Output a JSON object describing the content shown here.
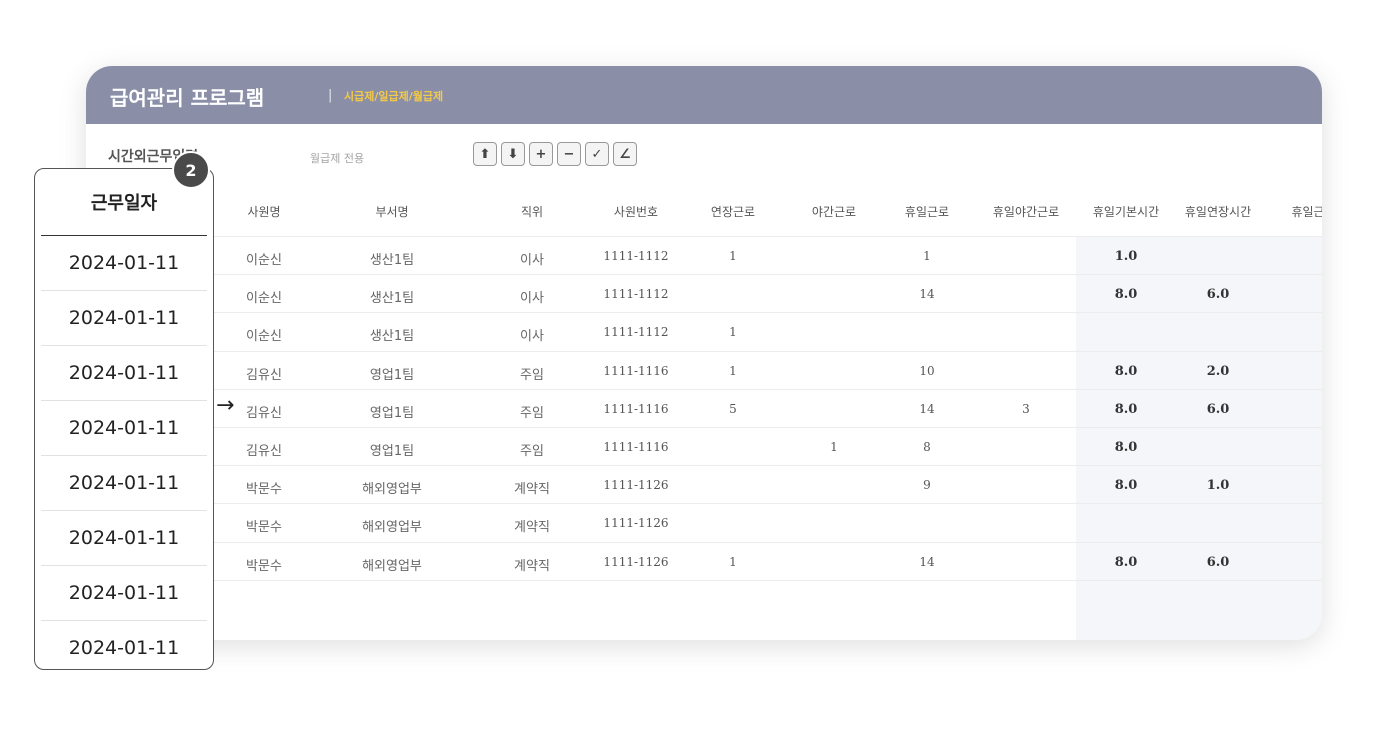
{
  "app": {
    "title": "급여관리 프로그램",
    "separator": "|",
    "subtitle": "시급제/일급제/월급제"
  },
  "section": {
    "label": "시간외근무입력",
    "note": "월급제 전용"
  },
  "toolbar": [
    {
      "name": "move-up-button",
      "icon": "arrow-up-icon",
      "glyph": "⬆"
    },
    {
      "name": "move-down-button",
      "icon": "arrow-down-icon",
      "glyph": "⬇"
    },
    {
      "name": "add-row-button",
      "icon": "plus-icon",
      "glyph": "+"
    },
    {
      "name": "remove-row-button",
      "icon": "minus-icon",
      "glyph": "−"
    },
    {
      "name": "confirm-button",
      "icon": "check-icon",
      "glyph": "✓"
    },
    {
      "name": "edit-button",
      "icon": "pencil-icon",
      "glyph": "∠"
    }
  ],
  "columns": [
    "사원명",
    "부서명",
    "직위",
    "사원번호",
    "연장근로",
    "야간근로",
    "휴일근로",
    "휴일야간근로",
    "휴일기본시간",
    "휴일연장시간",
    "휴일근"
  ],
  "rows": [
    [
      "이순신",
      "생산1팀",
      "이사",
      "1111-1112",
      "1",
      "",
      "1",
      "",
      "1.0",
      ""
    ],
    [
      "이순신",
      "생산1팀",
      "이사",
      "1111-1112",
      "",
      "",
      "14",
      "",
      "8.0",
      "6.0"
    ],
    [
      "이순신",
      "생산1팀",
      "이사",
      "1111-1112",
      "1",
      "",
      "",
      "",
      "",
      ""
    ],
    [
      "김유신",
      "영업1팀",
      "주임",
      "1111-1116",
      "1",
      "",
      "10",
      "",
      "8.0",
      "2.0"
    ],
    [
      "김유신",
      "영업1팀",
      "주임",
      "1111-1116",
      "5",
      "",
      "14",
      "3",
      "8.0",
      "6.0"
    ],
    [
      "김유신",
      "영업1팀",
      "주임",
      "1111-1116",
      "",
      "1",
      "8",
      "",
      "8.0",
      ""
    ],
    [
      "박문수",
      "해외영업부",
      "계약직",
      "1111-1126",
      "",
      "",
      "9",
      "",
      "8.0",
      "1.0"
    ],
    [
      "박문수",
      "해외영업부",
      "계약직",
      "1111-1126",
      "",
      "",
      "",
      "",
      "",
      ""
    ],
    [
      "박문수",
      "해외영업부",
      "계약직",
      "1111-1126",
      "1",
      "",
      "14",
      "",
      "8.0",
      "6.0"
    ]
  ],
  "popup": {
    "header": "근무일자",
    "dates": [
      "2024-01-11",
      "2024-01-11",
      "2024-01-11",
      "2024-01-11",
      "2024-01-11",
      "2024-01-11",
      "2024-01-11",
      "2024-01-11"
    ]
  },
  "badge": "2",
  "arrow": "→"
}
